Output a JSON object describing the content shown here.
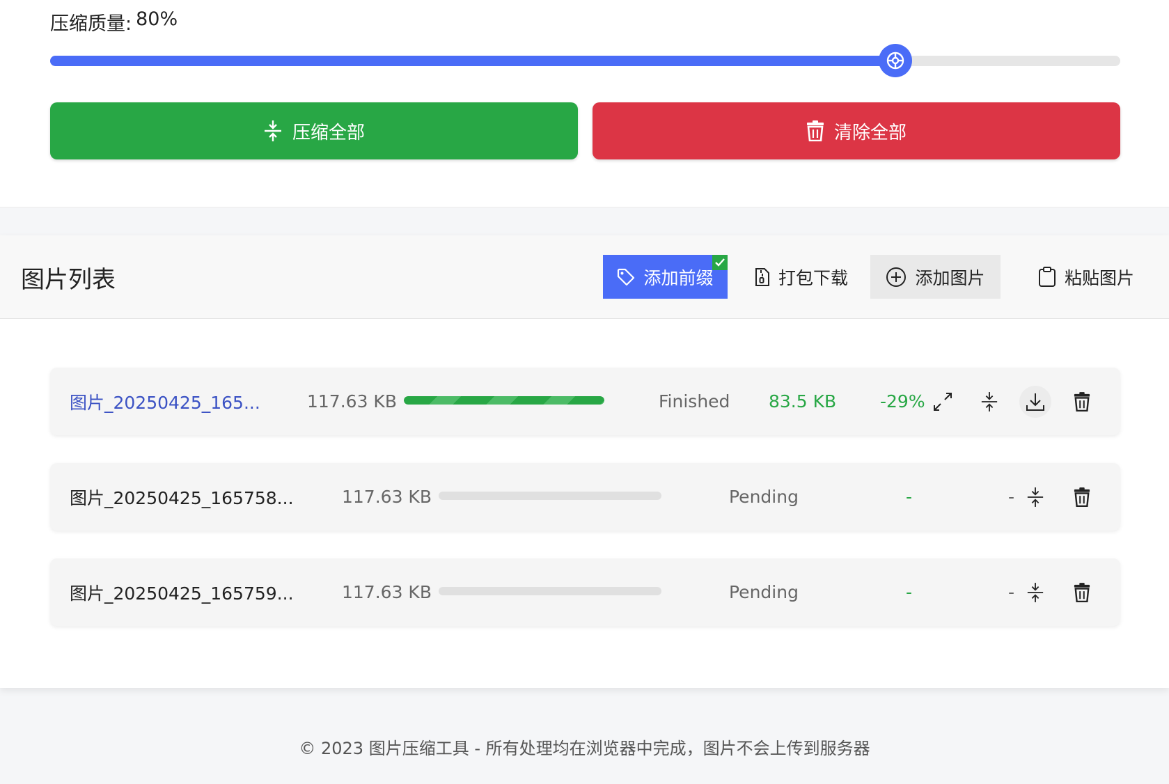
{
  "settings": {
    "quality_label": "压缩质量:",
    "quality_value": "80%",
    "quality_fraction": 0.79,
    "compress_all_label": "压缩全部",
    "clear_all_label": "清除全部"
  },
  "list": {
    "title": "图片列表",
    "toolbar": {
      "add_prefix_label": "添加前缀",
      "zip_download_label": "打包下载",
      "add_image_label": "添加图片",
      "paste_image_label": "粘贴图片"
    },
    "files": [
      {
        "name": "图片_20250425_165...",
        "size": "117.63 KB",
        "progress": 1.0,
        "status": "Finished",
        "new_size": "83.5 KB",
        "ratio": "-29%"
      },
      {
        "name": "图片_20250425_165758...",
        "size": "117.63 KB",
        "progress": 0,
        "status": "Pending",
        "new_size": "-",
        "ratio": "-"
      },
      {
        "name": "图片_20250425_165759...",
        "size": "117.63 KB",
        "progress": 0,
        "status": "Pending",
        "new_size": "-",
        "ratio": "-"
      }
    ]
  },
  "footer": {
    "text": "© 2023 图片压缩工具 - 所有处理均在浏览器中完成，图片不会上传到服务器"
  },
  "colors": {
    "primary": "#4a6cf7",
    "success": "#28a745",
    "danger": "#dc3545"
  }
}
